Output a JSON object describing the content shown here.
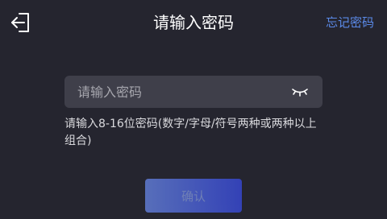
{
  "header": {
    "title": "请输入密码",
    "forgot_link": "忘记密码",
    "back_icon": "exit-arrow-icon"
  },
  "password_field": {
    "value": "",
    "placeholder": "请输入密码",
    "toggle_icon": "eye-closed-icon"
  },
  "hint": {
    "text": "请输入8-16位密码(数字/字母/符号两种或两种以上组合)"
  },
  "confirm_button": {
    "label": "确认",
    "enabled": false
  },
  "colors": {
    "background": "#25252f",
    "field_background": "#3f3f4a",
    "link": "#5b8ae8",
    "button_gradient_start": "#6d8ef5",
    "button_gradient_end": "#3a4ef0"
  }
}
